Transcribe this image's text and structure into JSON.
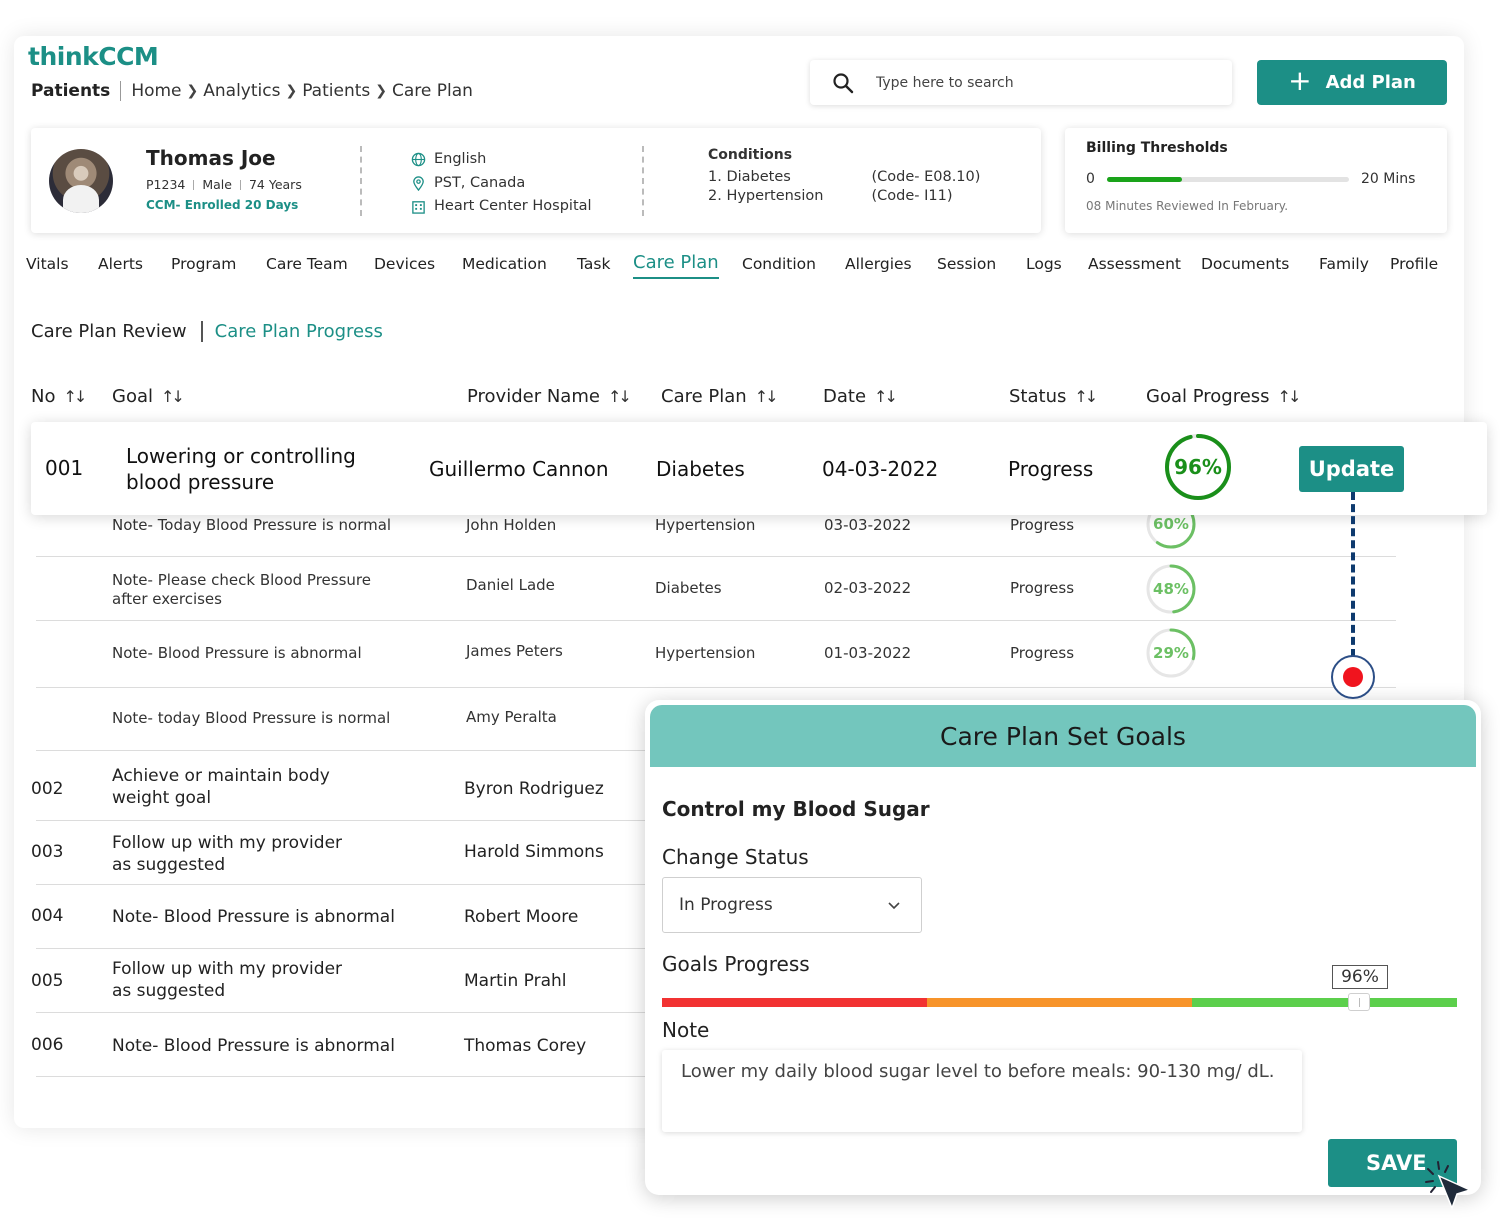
{
  "app": {
    "logo": "thinkCCM"
  },
  "breadcrumb": {
    "section": "Patients",
    "items": [
      "Home",
      "Analytics",
      "Patients",
      "Care Plan"
    ]
  },
  "search": {
    "placeholder": "Type here to search"
  },
  "actions": {
    "add_plan": "Add Plan"
  },
  "patient": {
    "name": "Thomas Joe",
    "id": "P1234",
    "gender": "Male",
    "age": "74 Years",
    "ccm": "CCM- Enrolled 20 Days",
    "language": "English",
    "timezone": "PST, Canada",
    "hospital": "Heart Center Hospital",
    "conditions_title": "Conditions",
    "conditions": [
      {
        "name": "1. Diabetes",
        "code": "(Code- E08.10)"
      },
      {
        "name": "2. Hypertension",
        "code": "(Code- I11)"
      }
    ]
  },
  "billing": {
    "title": "Billing Thresholds",
    "min": "0",
    "max": "20 Mins",
    "progress": 0.31,
    "subtitle": "08 Minutes Reviewed In February."
  },
  "tabs": [
    "Vitals",
    "Alerts",
    "Program",
    "Care Team",
    "Devices",
    "Medication",
    "Task",
    "Care Plan",
    "Condition",
    "Allergies",
    "Session",
    "Logs",
    "Assessment",
    "Documents",
    "Family",
    "Profile"
  ],
  "active_tab": "Care Plan",
  "subtabs": {
    "review": "Care Plan Review",
    "progress": "Care Plan Progress"
  },
  "table": {
    "headers": [
      "No",
      "Goal",
      "Provider Name",
      "Care Plan",
      "Date",
      "Status",
      "Goal Progress"
    ],
    "highlight": {
      "no": "001",
      "goal_line1": "Lowering or controlling",
      "goal_line2": "blood pressure",
      "provider": "Guillermo Cannon",
      "plan": "Diabetes",
      "date": "04-03-2022",
      "status": "Progress",
      "progress": 96,
      "progress_label": "96%",
      "action": "Update"
    },
    "notes": [
      {
        "line1": "Note- Today Blood Pressure is normal",
        "line2": "",
        "provider": "John  Holden",
        "plan": "Hypertension",
        "date": "03-03-2022",
        "status": "Progress",
        "progress": 60,
        "progress_label": "60%"
      },
      {
        "line1": "Note- Please check Blood Pressure",
        "line2": "after exercises",
        "provider": "Daniel Lade",
        "plan": "Diabetes",
        "date": "02-03-2022",
        "status": "Progress",
        "progress": 48,
        "progress_label": "48%"
      },
      {
        "line1": "Note- Blood Pressure is abnormal",
        "line2": "",
        "provider": "James Peters",
        "plan": "Hypertension",
        "date": "01-03-2022",
        "status": "Progress",
        "progress": 29,
        "progress_label": "29%"
      },
      {
        "line1": "Note- today Blood Pressure is normal",
        "line2": "",
        "provider": "Amy Peralta"
      }
    ],
    "rows": [
      {
        "no": "002",
        "line1": "Achieve or maintain body",
        "line2": "weight goal",
        "provider": "Byron Rodriguez"
      },
      {
        "no": "003",
        "line1": "Follow up with my provider",
        "line2": "as suggested",
        "provider": "Harold Simmons"
      },
      {
        "no": "004",
        "line1": "Note- Blood Pressure is abnormal",
        "line2": "",
        "provider": "Robert Moore"
      },
      {
        "no": "005",
        "line1": "Follow up with my provider",
        "line2": "as suggested",
        "provider": "Martin Prahl"
      },
      {
        "no": "006",
        "line1": "Note- Blood Pressure is abnormal",
        "line2": "",
        "provider": "Thomas Corey"
      }
    ]
  },
  "modal": {
    "title": "Care Plan Set Goals",
    "goal": "Control my Blood Sugar",
    "status_label": "Change Status",
    "status_value": "In Progress",
    "progress_label": "Goals Progress",
    "progress_value": "96%",
    "progress": 0.88,
    "note_label": "Note",
    "note_text": "Lower my daily blood sugar level to before meals: 90-130 mg/ dL.",
    "save": "SAVE",
    "bar_colors": [
      "#f23232",
      "#f7942a",
      "#5ccf4c"
    ]
  },
  "colors": {
    "accent": "#1c8f86",
    "modal_header": "#73c6bd",
    "ring_green": "#1a8f1a"
  }
}
